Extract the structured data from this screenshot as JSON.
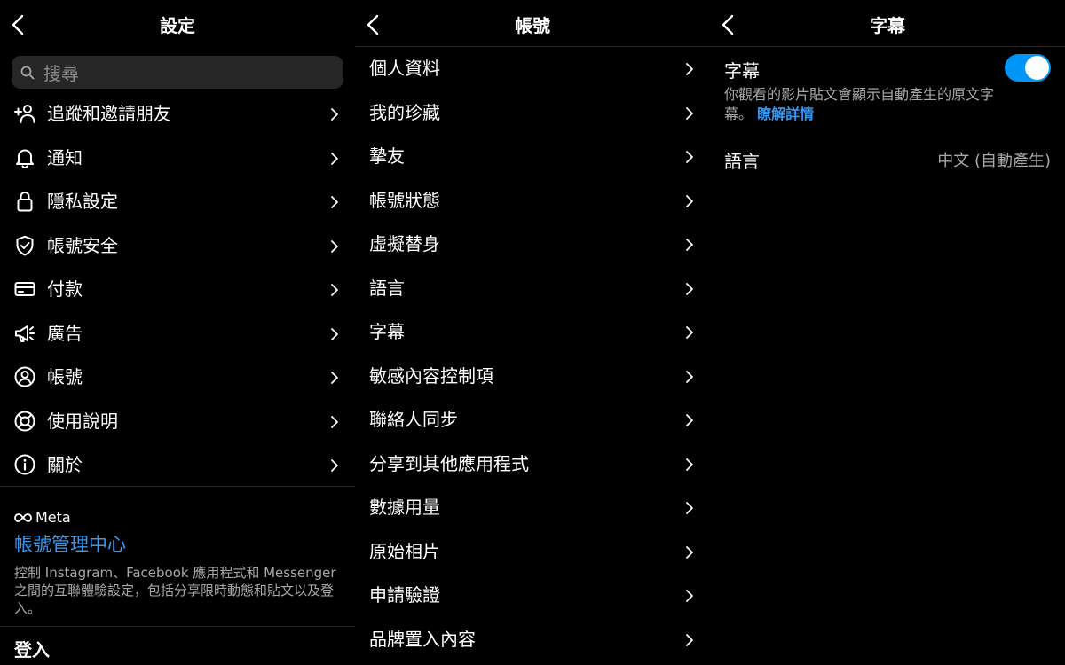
{
  "settings": {
    "title": "設定",
    "search_placeholder": "搜尋",
    "items": [
      {
        "label": "追蹤和邀請朋友",
        "icon": "add-person-icon"
      },
      {
        "label": "通知",
        "icon": "bell-icon"
      },
      {
        "label": "隱私設定",
        "icon": "lock-icon"
      },
      {
        "label": "帳號安全",
        "icon": "shield-check-icon"
      },
      {
        "label": "付款",
        "icon": "credit-card-icon"
      },
      {
        "label": "廣告",
        "icon": "megaphone-icon"
      },
      {
        "label": "帳號",
        "icon": "account-circle-icon"
      },
      {
        "label": "使用說明",
        "icon": "lifebuoy-icon"
      },
      {
        "label": "關於",
        "icon": "info-icon"
      }
    ],
    "meta": {
      "logo_text": "Meta",
      "center_link": "帳號管理中心",
      "description": "控制 Instagram、Facebook 應用程式和 Messenger 之間的互聯體驗設定，包括分享限時動態和貼文以及登入。"
    },
    "login_label": "登入"
  },
  "account": {
    "title": "帳號",
    "items": [
      "個人資料",
      "我的珍藏",
      "摯友",
      "帳號狀態",
      "虛擬替身",
      "語言",
      "字幕",
      "敏感內容控制項",
      "聯絡人同步",
      "分享到其他應用程式",
      "數據用量",
      "原始相片",
      "申請驗證",
      "品牌置入內容"
    ]
  },
  "captions": {
    "title": "字幕",
    "toggle_label": "字幕",
    "toggle_on": true,
    "description": "你觀看的影片貼文會顯示自動產生的原文字幕。",
    "learn_more": "瞭解詳情",
    "language_label": "語言",
    "language_value": "中文 (自動產生)"
  },
  "colors": {
    "background": "#000000",
    "accent_blue": "#0095f6",
    "link_blue": "#3897f0",
    "secondary_text": "#a8a8a8",
    "search_bg": "#262626"
  }
}
